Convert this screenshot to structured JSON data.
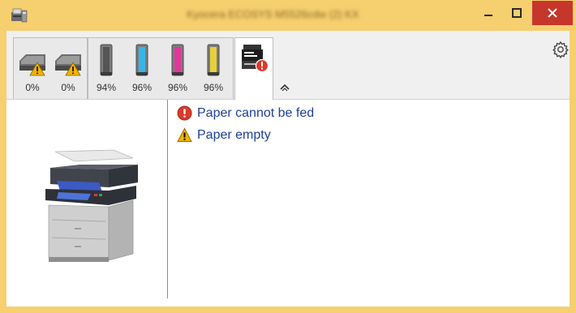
{
  "window": {
    "title": "Kyocera ECOSYS M5526cdw (2) KX",
    "minimize_label": "–",
    "maximize_label": "□",
    "close_label": "✕"
  },
  "toolbar": {
    "paper_trays": [
      {
        "name": "tray-1",
        "level": "0%",
        "icon": "paper-tray-warning-icon"
      },
      {
        "name": "tray-2",
        "level": "0%",
        "icon": "paper-tray-warning-icon"
      }
    ],
    "toners": [
      {
        "name": "black",
        "level": "94%",
        "color": "#555555",
        "fill": 0.94
      },
      {
        "name": "cyan",
        "level": "96%",
        "color": "#35b6e6",
        "fill": 0.96
      },
      {
        "name": "magenta",
        "level": "96%",
        "color": "#e1379a",
        "fill": 0.96
      },
      {
        "name": "yellow",
        "level": "96%",
        "color": "#e6d03a",
        "fill": 0.96
      }
    ],
    "device_icon": "printer-error-icon",
    "collapse_icon": "collapse-up-icon",
    "settings_icon": "gear-icon"
  },
  "status": {
    "messages": [
      {
        "text": "Paper cannot be fed",
        "icon": "error-icon",
        "severity": "error"
      },
      {
        "text": "Paper empty",
        "icon": "warning-icon",
        "severity": "warning"
      }
    ]
  },
  "colors": {
    "title_bar": "#f6cf6f",
    "close_button": "#c7362b",
    "status_text": "#1c3f9a",
    "error": "#d93a2b",
    "warning": "#f2b400"
  }
}
